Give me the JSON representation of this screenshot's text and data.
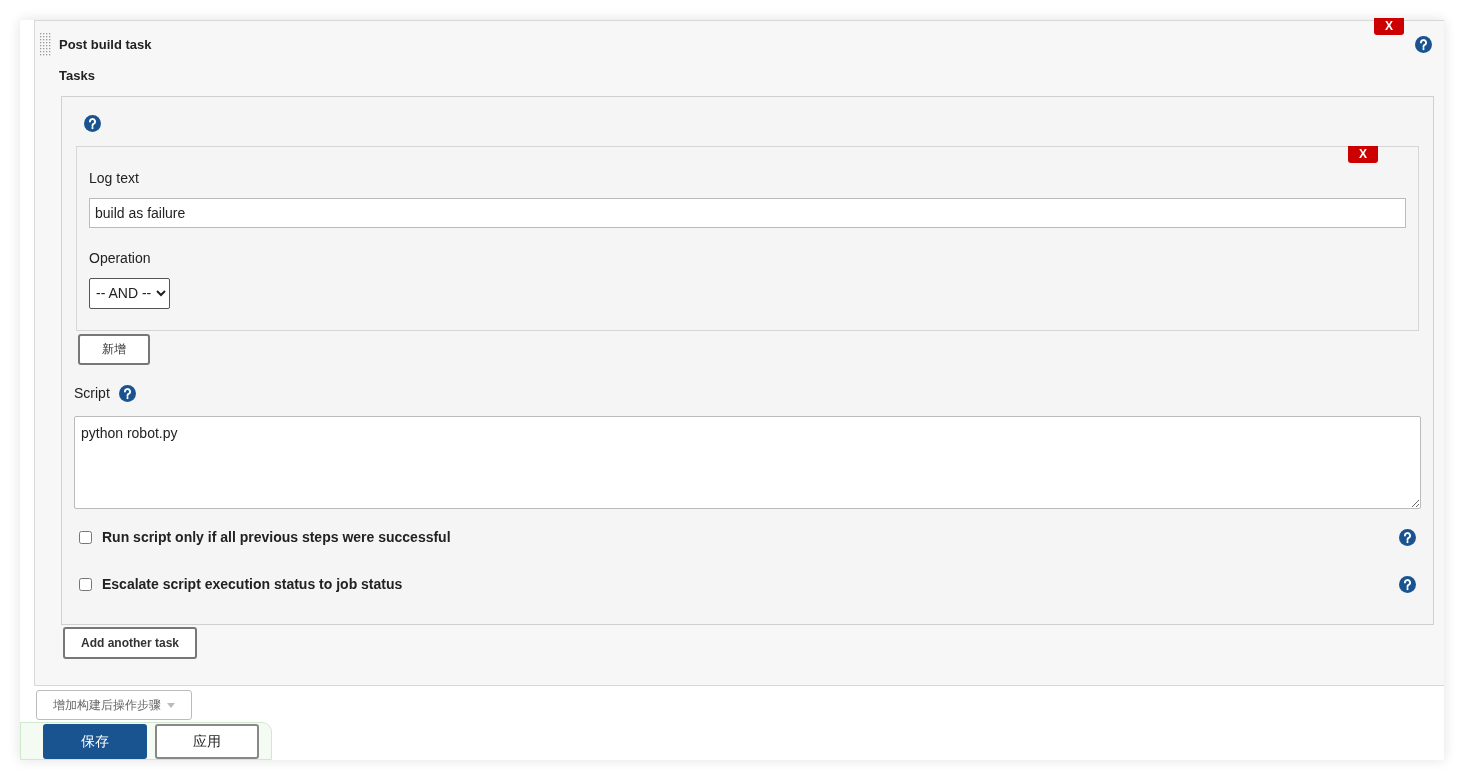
{
  "section": {
    "title": "Post build task",
    "delete_label": "X",
    "tasks_label": "Tasks",
    "log_conditions": [
      {
        "delete_label": "X",
        "log_text_label": "Log text",
        "log_text_value": "build as failure",
        "operation_label": "Operation",
        "operation_value": "-- AND --"
      }
    ],
    "add_condition_button": "新增",
    "script_label": "Script",
    "script_value": "python robot.py",
    "options": [
      {
        "label": "Run script only if all previous steps were successful",
        "checked": false
      },
      {
        "label": "Escalate script execution status to job status",
        "checked": false
      }
    ],
    "add_task_button": "Add another task"
  },
  "add_step_button": "增加构建后操作步骤",
  "footer_buttons": [
    {
      "label": "保存",
      "kind": "primary"
    },
    {
      "label": "应用",
      "kind": "secondary"
    }
  ]
}
